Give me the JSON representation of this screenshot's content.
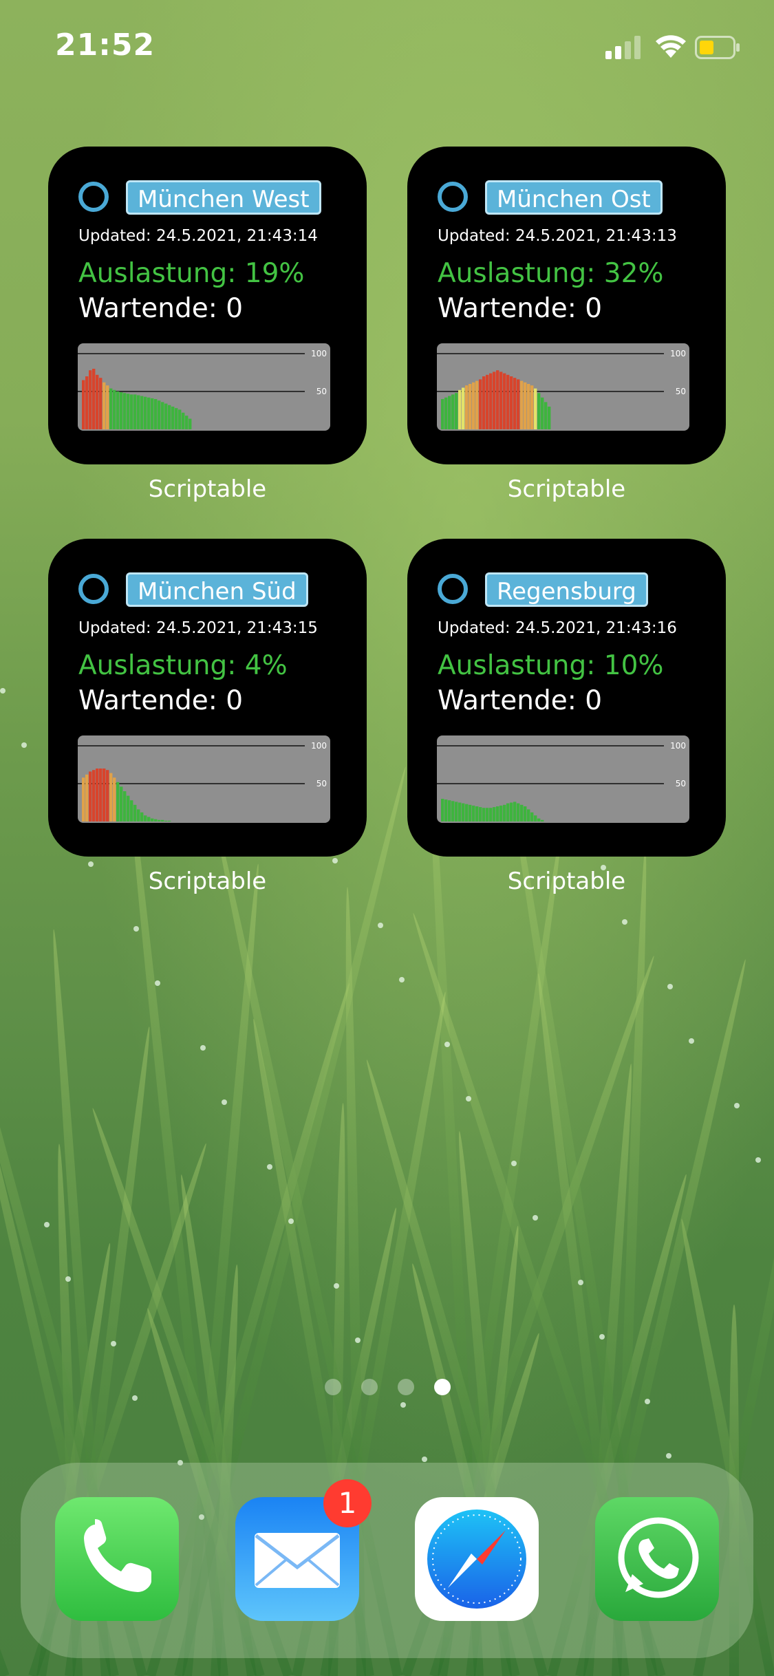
{
  "status_bar": {
    "time": "21:52"
  },
  "widgets": [
    {
      "name": "München West",
      "updated": "Updated: 24.5.2021, 21:43:14",
      "utilization": "Auslastung: 19%",
      "waiting": "Wartende: 0",
      "app_label": "Scriptable"
    },
    {
      "name": "München Ost",
      "updated": "Updated: 24.5.2021, 21:43:13",
      "utilization": "Auslastung: 32%",
      "waiting": "Wartende: 0",
      "app_label": "Scriptable"
    },
    {
      "name": "München Süd",
      "updated": "Updated: 24.5.2021, 21:43:15",
      "utilization": "Auslastung: 4%",
      "waiting": "Wartende: 0",
      "app_label": "Scriptable"
    },
    {
      "name": "Regensburg",
      "updated": "Updated: 24.5.2021, 21:43:16",
      "utilization": "Auslastung: 10%",
      "waiting": "Wartende: 0",
      "app_label": "Scriptable"
    }
  ],
  "chart_data": [
    {
      "type": "bar",
      "ylim": [
        0,
        110
      ],
      "yticks": [
        100,
        50
      ],
      "values": [
        65,
        70,
        78,
        80,
        72,
        68,
        62,
        58,
        54,
        52,
        50,
        49,
        48,
        47,
        46,
        46,
        45,
        44,
        43,
        42,
        41,
        40,
        38,
        36,
        34,
        32,
        30,
        28,
        26,
        22,
        18,
        14
      ]
    },
    {
      "type": "bar",
      "ylim": [
        0,
        110
      ],
      "yticks": [
        100,
        50
      ],
      "values": [
        40,
        42,
        44,
        46,
        48,
        52,
        55,
        58,
        60,
        62,
        64,
        66,
        70,
        72,
        74,
        76,
        78,
        76,
        74,
        72,
        70,
        68,
        66,
        64,
        62,
        60,
        58,
        54,
        48,
        42,
        36,
        30
      ]
    },
    {
      "type": "bar",
      "ylim": [
        0,
        110
      ],
      "yticks": [
        100,
        50
      ],
      "values": [
        58,
        62,
        66,
        68,
        70,
        70,
        70,
        68,
        64,
        58,
        52,
        46,
        40,
        34,
        28,
        22,
        16,
        12,
        8,
        6,
        4,
        3,
        2,
        2,
        1,
        1,
        0,
        0,
        0,
        0,
        0,
        0
      ]
    },
    {
      "type": "bar",
      "ylim": [
        0,
        110
      ],
      "yticks": [
        100,
        50
      ],
      "values": [
        30,
        29,
        28,
        27,
        26,
        25,
        24,
        23,
        22,
        21,
        20,
        19,
        18,
        18,
        18,
        19,
        20,
        21,
        22,
        24,
        25,
        26,
        24,
        22,
        20,
        16,
        12,
        8,
        4,
        2,
        0,
        0
      ]
    }
  ],
  "pagination": {
    "count": 4,
    "active": 3
  },
  "dock": {
    "apps": [
      {
        "icon": "phone-icon",
        "name": "Phone",
        "color": "#4cd964"
      },
      {
        "icon": "mail-icon",
        "name": "Mail",
        "color": "#2f8cf0",
        "badge": "1"
      },
      {
        "icon": "safari-icon",
        "name": "Safari",
        "color": "#ffffff"
      },
      {
        "icon": "whatsapp-icon",
        "name": "WhatsApp",
        "color": "#44c553"
      }
    ]
  },
  "colors": {
    "bar_low": "#3eb43e",
    "bar_mid": "#e3e36a",
    "bar_orange": "#e0a24a",
    "bar_high": "#d8442c",
    "chart_bg": "#8f8f8f"
  }
}
